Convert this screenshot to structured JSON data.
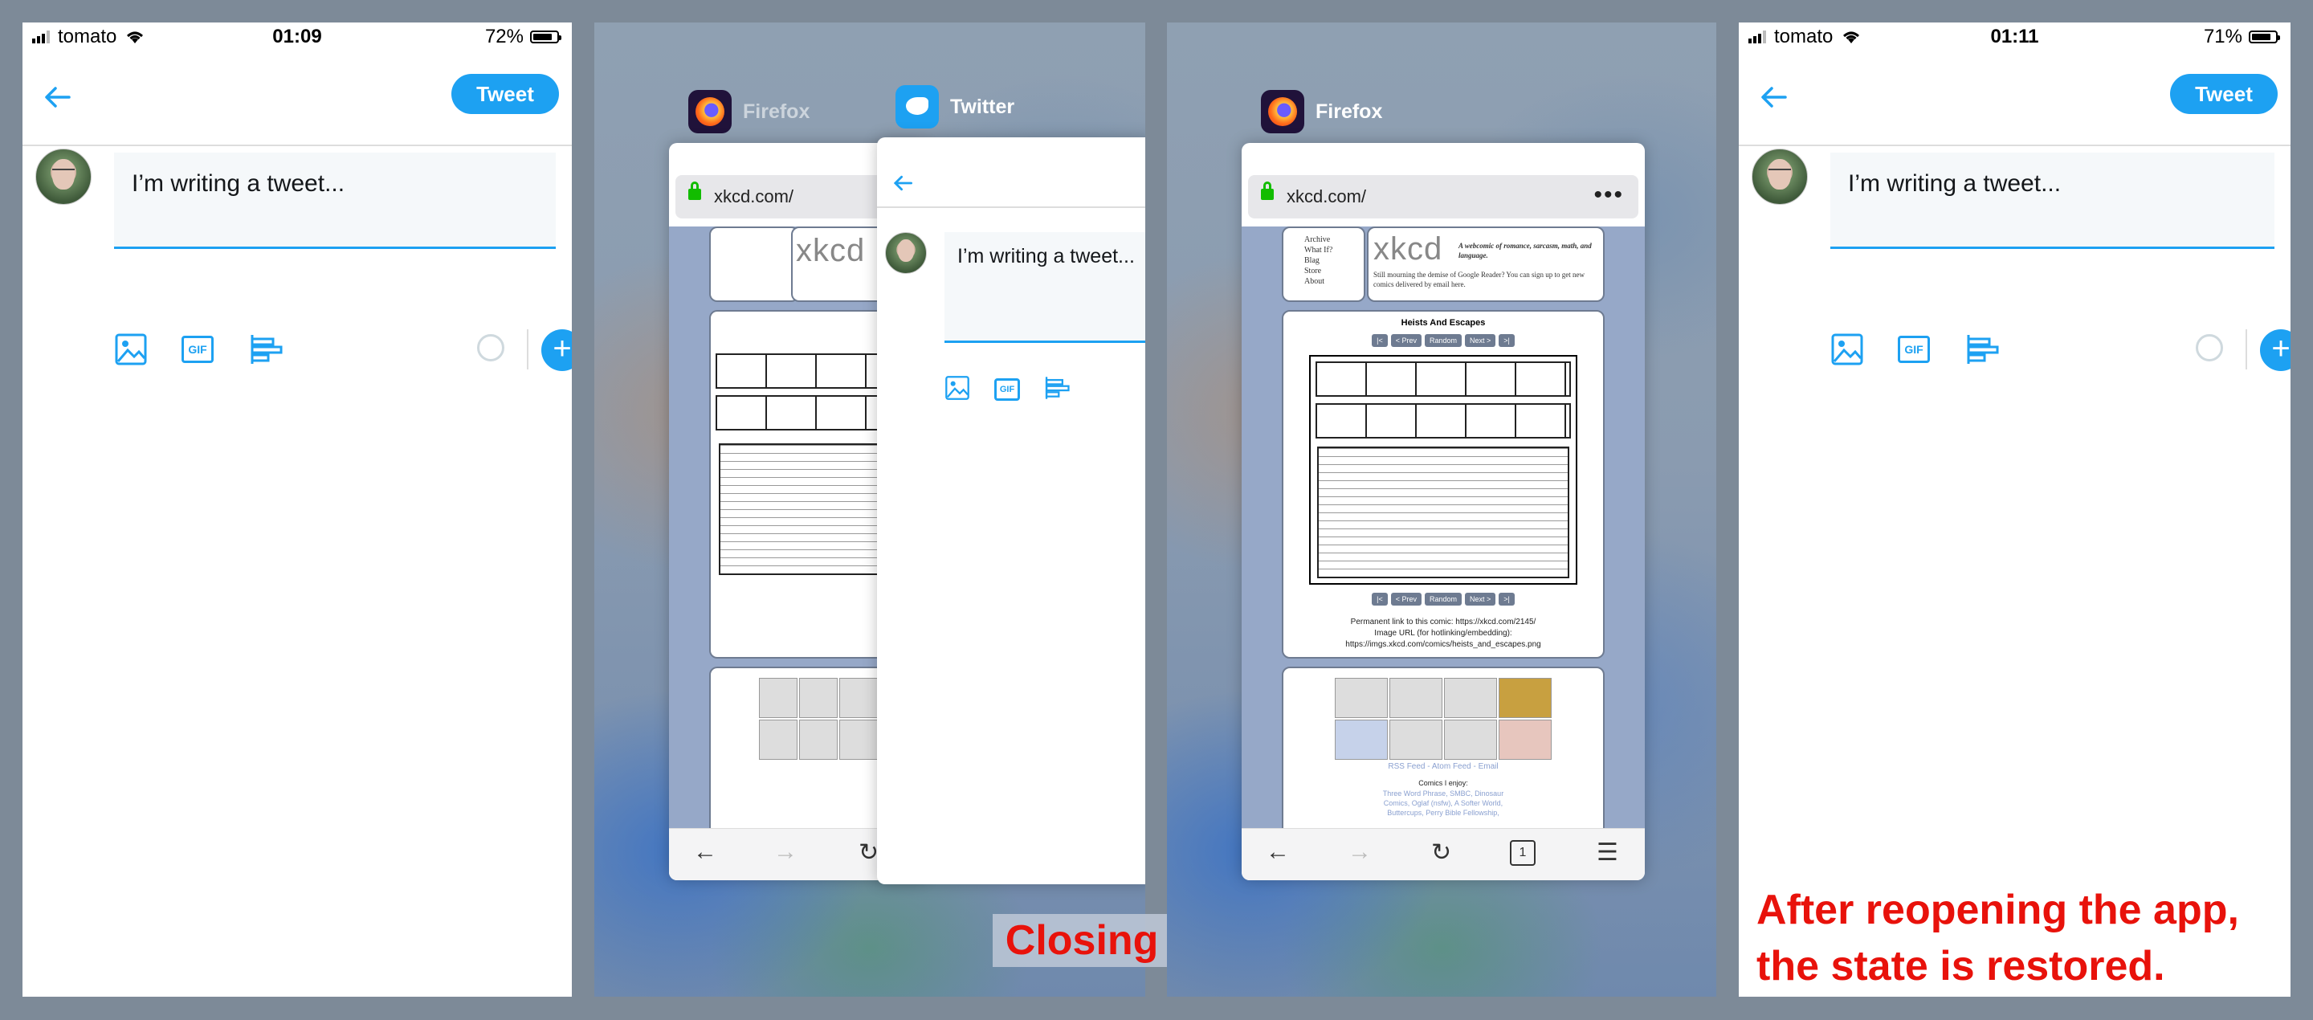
{
  "left_screen": {
    "status": {
      "carrier": "tomato",
      "time": "01:09",
      "battery": "72%",
      "battery_level": 0.72
    },
    "tweet_button": "Tweet",
    "compose_text": "I’m writing a tweet...",
    "gif_label": "GIF"
  },
  "switcher_screen": {
    "firefox_label": "Firefox",
    "twitter_label": "Twitter",
    "url": "xkcd.com/",
    "compose_text": "I’m writing a tweet...",
    "gif_label": "GIF"
  },
  "firefox_screen": {
    "firefox_label": "Firefox",
    "url": "xkcd.com/",
    "menu_dots": "•••",
    "tab_count": "1",
    "xkcd": {
      "nav_menu": [
        "Archive",
        "What If?",
        "Blag",
        "Store",
        "About"
      ],
      "logo": "xkcd",
      "tagline": "A webcomic of romance, sarcasm, math, and language.",
      "notice": "Still mourning the demise of Google Reader? You can sign up to get new comics delivered by email here.",
      "comic_title": "Heists And Escapes",
      "nav_buttons": [
        "|<",
        "< Prev",
        "Random",
        "Next >",
        ">|"
      ],
      "permalink": "Permanent link to this comic: https://xkcd.com/2145/",
      "image_url_label": "Image URL (for hotlinking/embedding):",
      "image_url": "https://imgs.xkcd.com/comics/heists_and_escapes.png",
      "feeds": "RSS Feed - Atom Feed - Email",
      "comics_i_enjoy": "Comics I enjoy:",
      "comics_list": "Three Word Phrase, SMBC, Dinosaur Comics, Oglaf (nsfw), A Softer World, Buttercups, Perry Bible Fellowship,"
    }
  },
  "right_screen": {
    "status": {
      "carrier": "tomato",
      "time": "01:11",
      "battery": "71%",
      "battery_level": 0.71
    },
    "tweet_button": "Tweet",
    "compose_text": "I’m writing a tweet...",
    "gif_label": "GIF"
  },
  "captions": {
    "closing": "Closing the app.",
    "restored_line1": "After reopening the app,",
    "restored_line2": "the state is restored."
  },
  "colors": {
    "twitter_blue": "#1da1f2",
    "caption_red": "#e8120b",
    "xkcd_blue": "#96a8c8",
    "lock_green": "#12bc00"
  }
}
